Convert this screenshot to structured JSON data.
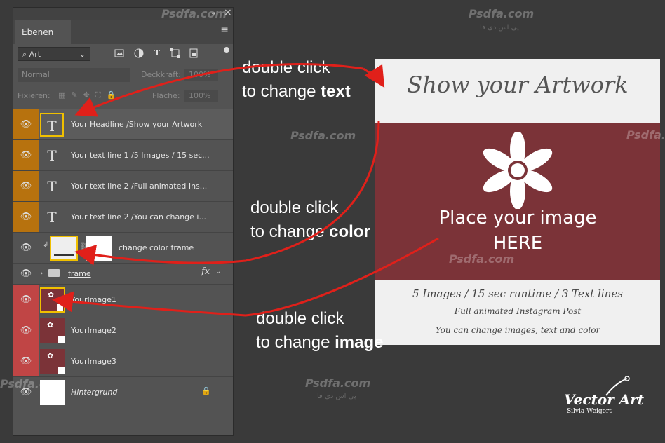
{
  "panel": {
    "window_controls": {
      "collapse": "«",
      "close": "×"
    },
    "tab_label": "Ebenen",
    "menu_icon": "≡",
    "filter": {
      "label": "Art",
      "search_glyph": "⌕",
      "arrow": "⌄"
    },
    "filter_icons": [
      "image-icon",
      "adjustment-icon",
      "type-icon",
      "shape-icon",
      "smartobject-icon"
    ],
    "blend_mode": "Normal",
    "opacity_label": "Deckkraft:",
    "opacity_value": "100%",
    "lock_label": "Fixieren:",
    "fill_label": "Fläche:",
    "fill_value": "100%",
    "layers": [
      {
        "name": "Your Headline /Show your Artwork",
        "kind": "text",
        "color_tag": "#b7720e"
      },
      {
        "name": "Your text line 1 /5 Images / 15 sec...",
        "kind": "text",
        "color_tag": "#b7720e"
      },
      {
        "name": "Your text line 2 /Full animated Ins...",
        "kind": "text",
        "color_tag": "#b7720e"
      },
      {
        "name": "Your text line 2 /You can change i...",
        "kind": "text",
        "color_tag": "#b7720e"
      },
      {
        "name": "change color frame",
        "kind": "fill",
        "color_tag": ""
      },
      {
        "name": "frame",
        "kind": "group",
        "color_tag": "",
        "fx": "fx"
      },
      {
        "name": "YourImage1",
        "kind": "smart",
        "color_tag": "#c04545"
      },
      {
        "name": "YourImage2",
        "kind": "smart",
        "color_tag": "#c04545"
      },
      {
        "name": "YourImage3",
        "kind": "smart",
        "color_tag": "#c04545"
      },
      {
        "name": "Hintergrund",
        "kind": "background",
        "color_tag": ""
      }
    ]
  },
  "annotations": {
    "text": {
      "line1": "double click",
      "line2": "to change",
      "bold": "text"
    },
    "color": {
      "line1": "double click",
      "line2": "to change",
      "bold": "color"
    },
    "image": {
      "line1": "double click",
      "line2": "to change",
      "bold": "image"
    }
  },
  "preview": {
    "title": "Show your Artwork",
    "place_line1": "Place your image",
    "place_line2": "HERE",
    "line1": "5 Images / 15 sec runtime / 3 Text lines",
    "line2": "Full animated Instagram Post",
    "line3": "You can change images, text and color",
    "accent_color": "#7b3338"
  },
  "watermark": {
    "text": "Psdfa.com",
    "subtext": "پی اس دی فا"
  },
  "logo": {
    "title": "Vector Art",
    "subtitle": "Silvia Weigert"
  },
  "arrow_color": "#e0201a"
}
